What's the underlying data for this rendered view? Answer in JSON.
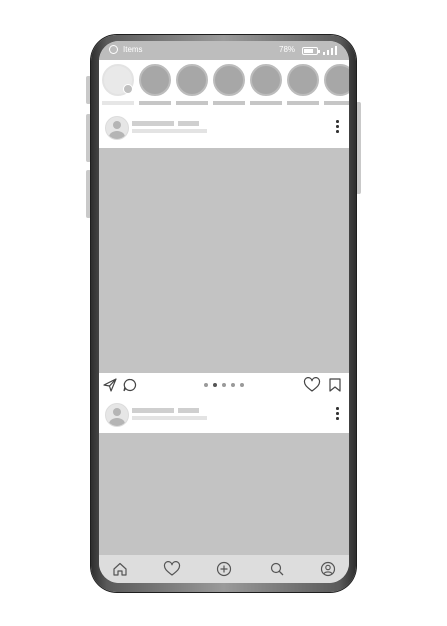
{
  "status_bar": {
    "app_title": "Items",
    "battery_percent": "78%",
    "battery_level": 0.78,
    "signal_icon": "signal-bars-icon",
    "battery_icon": "battery-icon"
  },
  "stories": {
    "own_story_icon": "add-story-icon",
    "count": 7
  },
  "posts": [
    {
      "menu_icon": "more-vertical-icon"
    },
    {
      "menu_icon": "more-vertical-icon"
    }
  ],
  "post_actions": {
    "share_icon": "send-icon",
    "comment_icon": "comment-icon",
    "like_icon": "heart-icon",
    "save_icon": "bookmark-icon",
    "carousel_page": 2,
    "carousel_total": 5
  },
  "tab_bar": {
    "tabs": [
      "home-icon",
      "heart-icon",
      "add-post-icon",
      "search-icon",
      "profile-icon"
    ]
  },
  "colors": {
    "placeholder_gray": "#c3c3c3",
    "status_bar": "#bdbdbd",
    "tab_bar": "#dddddd",
    "phone_frame": "#2e2e2e"
  }
}
